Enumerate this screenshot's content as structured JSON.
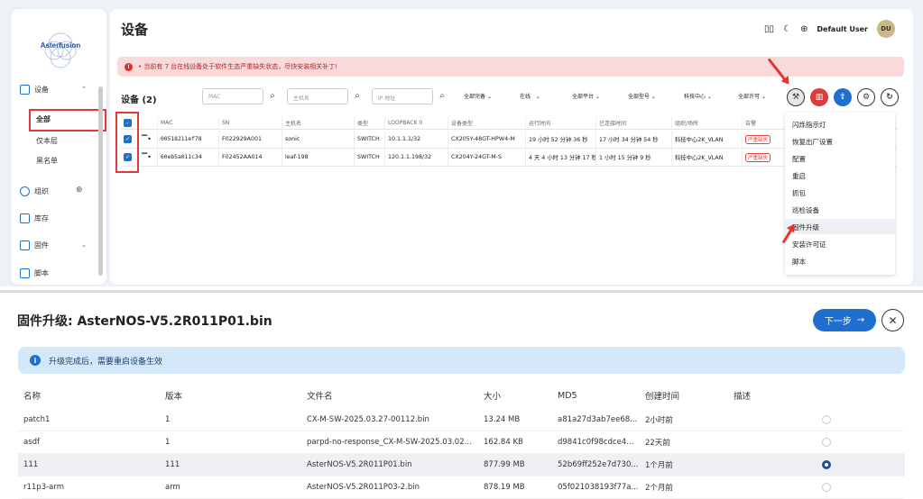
{
  "sidebar": {
    "logo_text": "Asterfusion",
    "devices_label": "设备",
    "sub_all": "全部",
    "sub_offline": "仅本层",
    "sub_blacklist": "黑名单",
    "org_label": "组织",
    "inventory_label": "库存",
    "firmware_label": "固件",
    "script_label": "脚本"
  },
  "header": {
    "page_title": "设备",
    "user_name": "Default User",
    "avatar_initials": "DU"
  },
  "alert": {
    "text": "• 当前有 7 台在线设备处于软件生态严重缺失状态，尽快安装相关补丁!"
  },
  "toolbar": {
    "title": "设备 (2)",
    "mac_placeholder": "MAC",
    "hostname_placeholder": "主机名",
    "ip_placeholder": "IP 地址",
    "filter_health": "全部完备",
    "filter_online": "在线",
    "filter_platform": "全部平台",
    "filter_model": "全部型号",
    "filter_site": "科技中心",
    "filter_license": "全部许可"
  },
  "table": {
    "headers": [
      "MAC",
      "SN",
      "主机名",
      "类型",
      "LOOPBACK 0",
      "设备类型",
      "运行时间",
      "已连接时间",
      "组织/场所",
      "告警"
    ],
    "rows": [
      [
        "00518211ef78",
        "F022929A001",
        "sonic",
        "SWITCH",
        "10.1.1.1/32",
        "CX205Y-48GT-HPW4-M",
        "19 小时 52 分钟 36 秒",
        "17 小时 34 分钟 54 秒",
        "科技中心2K_VLAN",
        "严重缺失"
      ],
      [
        "60eb5a011c34",
        "F02452AA014",
        "leaf-198",
        "SWITCH",
        "120.1.1.198/32",
        "CX204Y-24GT-M-S",
        "4 天 4 小时 13 分钟 17 秒",
        "1 小时 15 分钟 9 秒",
        "科技中心2K_VLAN",
        "严重缺失"
      ]
    ]
  },
  "menu": {
    "items": [
      "闪烁指示灯",
      "恢复出厂设置",
      "配置",
      "重启",
      "抓包",
      "巡检设备",
      "固件升级",
      "安装许可证",
      "脚本"
    ]
  },
  "firmware": {
    "title": "固件升级: AsterNOS-V5.2R011P01.bin",
    "next_label": "下一步",
    "info_text": "升级完成后，需要重启设备生效",
    "headers": [
      "名称",
      "版本",
      "文件名",
      "大小",
      "MD5",
      "创建时间",
      "描述"
    ],
    "rows": [
      [
        "patch1",
        "1",
        "CX-M-SW-2025.03.27-00112.bin",
        "13.24 MB",
        "a81a27d3ab7ee68...",
        "2小时前",
        ""
      ],
      [
        "asdf",
        "1",
        "parpd-no-response_CX-M-SW-2025.03.02...",
        "162.84 KB",
        "d9841c0f98cdce4...",
        "22天前",
        ""
      ],
      [
        "111",
        "111",
        "AsterNOS-V5.2R011P01.bin",
        "877.99 MB",
        "52b69ff252e7d730...",
        "1个月前",
        ""
      ],
      [
        "r11p3-arm",
        "arm",
        "AsterNOS-V5.2R011P03-2.bin",
        "878.19 MB",
        "05f021038193f77a...",
        "2个月前",
        ""
      ]
    ],
    "selected_row": 2
  }
}
